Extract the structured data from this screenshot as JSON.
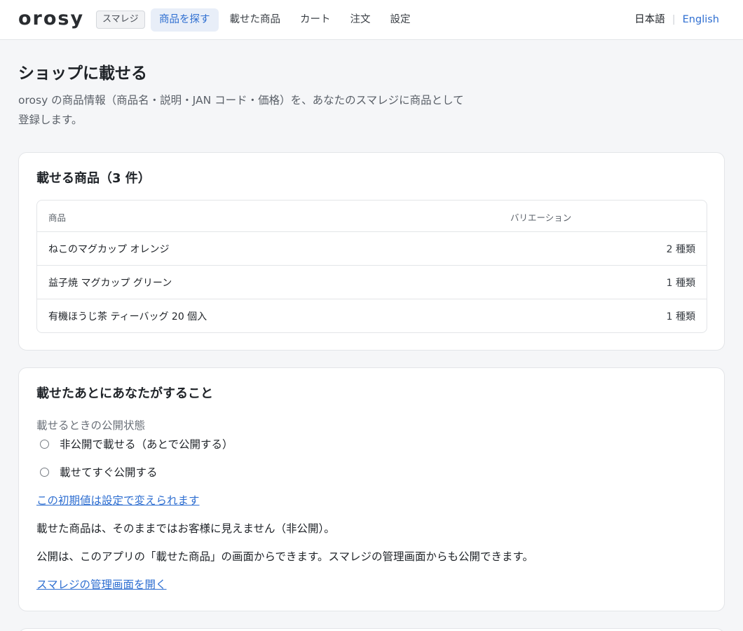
{
  "header": {
    "logo": "orosy",
    "badge": "スマレジ",
    "nav": [
      {
        "label": "商品を探す",
        "active": true
      },
      {
        "label": "載せた商品",
        "active": false
      },
      {
        "label": "カート",
        "active": false
      },
      {
        "label": "注文",
        "active": false
      },
      {
        "label": "設定",
        "active": false
      }
    ],
    "lang": {
      "ja": "日本語",
      "separator": "|",
      "en": "English"
    }
  },
  "page": {
    "title": "ショップに載せる",
    "description": "orosy の商品情報（商品名・説明・JAN コード・価格）を、あなたのスマレジに商品として登録します。"
  },
  "products_card": {
    "title": "載せる商品（3 件）",
    "columns": {
      "product": "商品",
      "variation": "バリエーション"
    },
    "rows": [
      {
        "name": "ねこのマグカップ オレンジ",
        "variation": "2 種類"
      },
      {
        "name": "益子焼 マグカップ グリーン",
        "variation": "1 種類"
      },
      {
        "name": "有機ほうじ茶 ティーバッグ 20 個入",
        "variation": "1 種類"
      }
    ]
  },
  "after_card": {
    "title": "載せたあとにあなたがすること",
    "visibility_label": "載せるときの公開状態",
    "options": [
      {
        "label": "非公開で載せる（あとで公開する）",
        "selected": false
      },
      {
        "label": "載せてすぐ公開する",
        "selected": false
      }
    ],
    "settings_link": "この初期値は設定で変えられます",
    "note_1": "載せた商品は、そのままではお客様に見えません（非公開）。",
    "note_2": "公開は、このアプリの「載せた商品」の画面からできます。スマレジの管理画面からも公開できます。",
    "admin_link": "スマレジの管理画面を開く"
  },
  "colors": {
    "accent": "#2f6fd1",
    "background": "#f5f6f8",
    "border": "#e3e5e8"
  }
}
